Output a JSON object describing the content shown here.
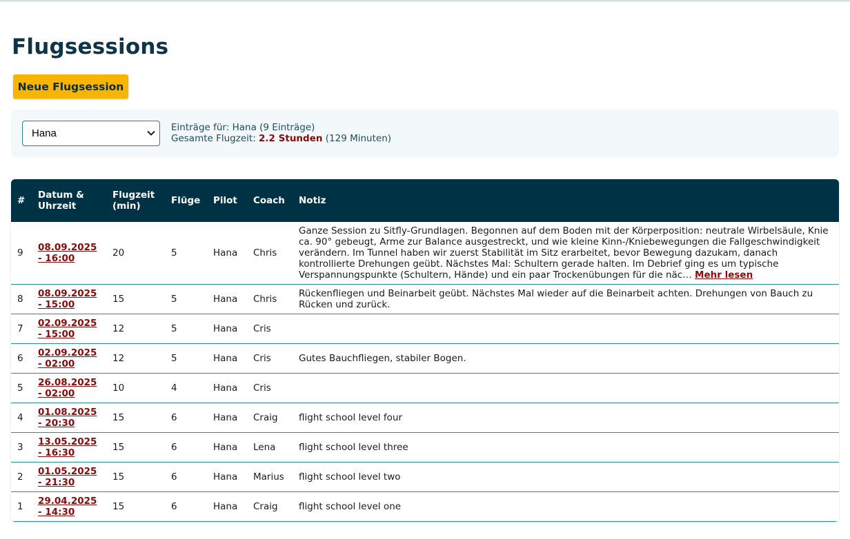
{
  "page": {
    "title": "Flugsessions"
  },
  "actions": {
    "new_session_label": "Neue Flugsession"
  },
  "filter": {
    "selected_pilot": "Hana",
    "entries_prefix": "Einträge für: ",
    "entries_name": "Hana",
    "entries_count": " (9 Einträge)",
    "total_prefix": "Gesamte Flugzeit: ",
    "total_hours": "2.2 Stunden",
    "total_minutes": " (129 Minuten)"
  },
  "table": {
    "columns": [
      "#",
      "Datum & Uhrzeit",
      "Flugzeit (min)",
      "Flüge",
      "Pilot",
      "Coach",
      "Notiz"
    ],
    "more_label": "Mehr lesen",
    "rows": [
      {
        "num": "9",
        "date": "08.09.2025 - 16:00",
        "duration": "20",
        "flights": "5",
        "pilot": "Hana",
        "coach": "Chris",
        "note": "Ganze Session zu Sitfly-Grundlagen. Begonnen auf dem Boden mit der Körperposition: neutrale Wirbelsäule, Knie ca. 90° gebeugt, Arme zur Balance ausgestreckt, und wie kleine Kinn-/Kniebewegungen die Fallgeschwindigkeit verändern. Im Tunnel haben wir zuerst Stabilität im Sitz erarbeitet, bevor Bewegung dazukam, danach kontrollierte Drehungen geübt. Nächstes Mal: Schultern gerade halten. Im Debrief ging es um typische Verspannungspunkte (Schultern, Hände) und ein paar Trockenübungen für die näc…"
      },
      {
        "num": "8",
        "date": "08.09.2025 - 15:00",
        "duration": "15",
        "flights": "5",
        "pilot": "Hana",
        "coach": "Chris",
        "note": "Rückenfliegen und Beinarbeit geübt. Nächstes Mal wieder auf die Beinarbeit achten. Drehungen von Bauch zu Rücken und zurück."
      },
      {
        "num": "7",
        "date": "02.09.2025 - 15:00",
        "duration": "12",
        "flights": "5",
        "pilot": "Hana",
        "coach": "Cris",
        "note": ""
      },
      {
        "num": "6",
        "date": "02.09.2025 - 02:00",
        "duration": "12",
        "flights": "5",
        "pilot": "Hana",
        "coach": "Cris",
        "note": "Gutes Bauchfliegen, stabiler Bogen."
      },
      {
        "num": "5",
        "date": "26.08.2025 - 02:00",
        "duration": "10",
        "flights": "4",
        "pilot": "Hana",
        "coach": "Cris",
        "note": ""
      },
      {
        "num": "4",
        "date": "01.08.2025 - 20:30",
        "duration": "15",
        "flights": "6",
        "pilot": "Hana",
        "coach": "Craig",
        "note": "flight school level four"
      },
      {
        "num": "3",
        "date": "13.05.2025 - 16:30",
        "duration": "15",
        "flights": "6",
        "pilot": "Hana",
        "coach": "Lena",
        "note": "flight school level three"
      },
      {
        "num": "2",
        "date": "01.05.2025 - 21:30",
        "duration": "15",
        "flights": "6",
        "pilot": "Hana",
        "coach": "Marius",
        "note": "flight school level two"
      },
      {
        "num": "1",
        "date": "29.04.2025 - 14:30",
        "duration": "15",
        "flights": "6",
        "pilot": "Hana",
        "coach": "Craig",
        "note": "flight school level one"
      }
    ]
  }
}
